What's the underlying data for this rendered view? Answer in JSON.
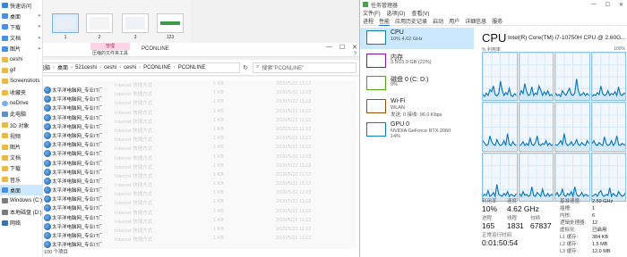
{
  "nav": {
    "items": [
      {
        "label": "快速访问",
        "icon": "star-icon",
        "pinned": false
      },
      {
        "label": "桌面",
        "icon": "desktop-icon",
        "pinned": true
      },
      {
        "label": "下载",
        "icon": "download-icon",
        "pinned": true
      },
      {
        "label": "文档",
        "icon": "document-icon",
        "pinned": true
      },
      {
        "label": "图片",
        "icon": "picture-icon",
        "pinned": true
      },
      {
        "label": "ceshi",
        "icon": "folder-icon",
        "pinned": false
      },
      {
        "label": "gif",
        "icon": "folder-icon",
        "pinned": false
      },
      {
        "label": "Screenshots",
        "icon": "folder-icon",
        "pinned": false
      },
      {
        "label": "收藏夹",
        "icon": "folder-icon",
        "pinned": false
      },
      {
        "label": "neDrive",
        "icon": "cloud-icon",
        "pinned": false
      },
      {
        "label": "此电脑",
        "icon": "pc-icon",
        "pinned": false
      },
      {
        "label": "3D 对象",
        "icon": "folder-icon",
        "pinned": false
      },
      {
        "label": "视频",
        "icon": "folder-icon",
        "pinned": false
      },
      {
        "label": "图片",
        "icon": "folder-icon",
        "pinned": false
      },
      {
        "label": "文档",
        "icon": "folder-icon",
        "pinned": false
      },
      {
        "label": "下载",
        "icon": "folder-icon",
        "pinned": false
      },
      {
        "label": "音乐",
        "icon": "folder-icon",
        "pinned": false
      },
      {
        "label": "桌面",
        "icon": "desktop-icon",
        "pinned": false,
        "selected": true
      },
      {
        "label": "Windows (C:)",
        "icon": "drive-icon",
        "pinned": false
      },
      {
        "label": "本地磁盘 (D:)",
        "icon": "drive-icon",
        "pinned": false
      },
      {
        "label": "网络",
        "icon": "network-icon",
        "pinned": false
      }
    ]
  },
  "explorer": {
    "thumbnails": [
      {
        "label": "1",
        "selected": true
      },
      {
        "label": "2",
        "selected": false
      },
      {
        "label": "3",
        "selected": false
      },
      {
        "label": "123",
        "selected": false
      }
    ],
    "ribbon": {
      "manage_tab": "管理",
      "tools_tab": "压缩的文件夹工具",
      "context_title": "PCONLINE"
    },
    "window_controls": {
      "minimize": "—",
      "maximize": "☐",
      "close": "✕"
    },
    "address": {
      "back": "←",
      "forward": "→",
      "up": "↑",
      "crumbs": [
        "此电脑",
        "桌面",
        "521ceshi",
        "ceshi",
        "ceshi",
        "PCONLINE",
        "PCONLINE"
      ],
      "refresh": "↻",
      "search_placeholder": "搜索\"PCONLINE\""
    },
    "files": [
      {
        "name": "太平洋电脑网_专业IT门户网站",
        "type": "Internet 快捷方式",
        "size": "1 KB",
        "date": "2020/5/22 11:12"
      },
      {
        "name": "太平洋电脑网_专业IT门户网站",
        "type": "Internet 快捷方式",
        "size": "1 KB",
        "date": "2020/5/22 11:12"
      },
      {
        "name": "太平洋电脑网_专业IT门户网站",
        "type": "Internet 快捷方式",
        "size": "1 KB",
        "date": "2020/5/22 11:12"
      },
      {
        "name": "太平洋电脑网_专业IT门户网站",
        "type": "Internet 快捷方式",
        "size": "1 KB",
        "date": "2020/5/22 11:12"
      },
      {
        "name": "太平洋电脑网_专业IT门户网站",
        "type": "Internet 快捷方式",
        "size": "1 KB",
        "date": "2020/5/22 11:12"
      },
      {
        "name": "太平洋电脑网_专业IT门户网站",
        "type": "Internet 快捷方式",
        "size": "1 KB",
        "date": "2020/5/22 11:12"
      },
      {
        "name": "太平洋电脑网_专业IT门户网站",
        "type": "Internet 快捷方式",
        "size": "1 KB",
        "date": "2020/5/22 11:12"
      },
      {
        "name": "太平洋电脑网_专业IT门户网站",
        "type": "Internet 快捷方式",
        "size": "1 KB",
        "date": "2020/5/22 11:12"
      },
      {
        "name": "太平洋电脑网_专业IT门户网站",
        "type": "Internet 快捷方式",
        "size": "1 KB",
        "date": "2020/5/22 11:12"
      },
      {
        "name": "太平洋电脑网_专业IT门户网站",
        "type": "Internet 快捷方式",
        "size": "1 KB",
        "date": "2020/5/22 11:12"
      },
      {
        "name": "太平洋电脑网_专业IT门户网站",
        "type": "Internet 快捷方式",
        "size": "1 KB",
        "date": "2020/5/22 11:12"
      },
      {
        "name": "太平洋电脑网_专业IT门户网站",
        "type": "Internet 快捷方式",
        "size": "1 KB",
        "date": "2020/5/22 11:12"
      },
      {
        "name": "太平洋电脑网_专业IT门户网站",
        "type": "Internet 快捷方式",
        "size": "1 KB",
        "date": "2020/5/22 11:12"
      },
      {
        "name": "太平洋电脑网_专业IT门户网站",
        "type": "Internet 快捷方式",
        "size": "1 KB",
        "date": "2020/5/22 11:12"
      },
      {
        "name": "太平洋电脑网_专业IT门户网站",
        "type": "Internet 快捷方式",
        "size": "1 KB",
        "date": "2020/5/22 11:12"
      },
      {
        "name": "太平洋电脑网_专业IT门户网站",
        "type": "Internet 快捷方式",
        "size": "1 KB",
        "date": "2020/5/22 11:12"
      },
      {
        "name": "太平洋电脑网_专业IT门户网站",
        "type": "Internet 快捷方式",
        "size": "1 KB",
        "date": "2020/5/22 11:12"
      },
      {
        "name": "太平洋电脑网_专业IT门户网站",
        "type": "Internet 快捷方式",
        "size": "1 KB",
        "date": "2020/5/22 11:12"
      }
    ],
    "status": "1,586 个项目    选中 100 个项目"
  },
  "taskmgr": {
    "title": "任务管理器",
    "window_controls": {
      "minimize": "—",
      "maximize": "☐",
      "close": "✕"
    },
    "menu": [
      "文件(F)",
      "选项(O)",
      "查看(V)"
    ],
    "tabs": [
      "进程",
      "性能",
      "应用历史记录",
      "启动",
      "用户",
      "详细信息",
      "服务"
    ],
    "active_tab": "性能",
    "resources": [
      {
        "name": "CPU",
        "sub": "10% 4.62 GHz",
        "sub2": "",
        "color": "#117dbb",
        "selected": true
      },
      {
        "name": "内存",
        "sub": "3.5/15.9 GB (22%)",
        "sub2": "",
        "color": "#8b12ae",
        "selected": false
      },
      {
        "name": "磁盘 0 (C: D:)",
        "sub": "0%",
        "sub2": "",
        "color": "#4da60c",
        "selected": false
      },
      {
        "name": "Wi-Fi",
        "sub": "WLAN",
        "sub2": "发送: 0 接收: 96.0 Kbps",
        "color": "#a74f01",
        "selected": false
      },
      {
        "name": "GPU 0",
        "sub": "NVIDIA GeForce RTX 2060",
        "sub2": "14%",
        "color": "#117dbb",
        "selected": false
      }
    ],
    "cpu": {
      "heading": "CPU",
      "model": "Intel(R) Core(TM) i7-10750H CPU @ 2.60G...",
      "graph_caption_left": "% 利用率",
      "graph_caption_right": "100%",
      "utilization_label": "利用率",
      "utilization": "10%",
      "speed_label": "速度",
      "speed": "4.62 GHz",
      "processes_label": "进程",
      "processes": "165",
      "threads_label": "线程",
      "threads": "1831",
      "handles_label": "句柄",
      "handles": "67837",
      "uptime_label": "正常运行时间",
      "uptime": "0:01:50:54",
      "details": [
        {
          "k": "基准速度:",
          "v": "2.59 GHz"
        },
        {
          "k": "插槽:",
          "v": "1"
        },
        {
          "k": "内核:",
          "v": "6"
        },
        {
          "k": "逻辑处理器:",
          "v": "12"
        },
        {
          "k": "虚拟化:",
          "v": "已启用"
        },
        {
          "k": "L1 缓存:",
          "v": "384 KB"
        },
        {
          "k": "L2 缓存:",
          "v": "1.5 MB"
        },
        {
          "k": "L3 缓存:",
          "v": "12.0 MB"
        }
      ],
      "cores": [
        [
          0.12,
          0.08,
          0.15,
          0.1,
          0.22,
          0.18,
          0.3,
          0.12,
          0.09,
          0.14,
          0.4,
          0.2,
          0.1,
          0.16,
          0.12,
          0.25,
          0.1,
          0.08,
          0.14,
          0.1
        ],
        [
          0.1,
          0.2,
          0.14,
          0.35,
          0.18,
          0.1,
          0.12,
          0.28,
          0.1,
          0.15,
          0.12,
          0.3,
          0.22,
          0.1,
          0.18,
          0.12,
          0.2,
          0.1,
          0.12,
          0.09
        ],
        [
          0.15,
          0.1,
          0.12,
          0.08,
          0.2,
          0.14,
          0.1,
          0.18,
          0.25,
          0.12,
          0.1,
          0.15,
          0.45,
          0.2,
          0.1,
          0.12,
          0.16,
          0.1,
          0.14,
          0.1
        ],
        [
          0.08,
          0.12,
          0.1,
          0.16,
          0.12,
          0.3,
          0.14,
          0.1,
          0.12,
          0.2,
          0.1,
          0.14,
          0.12,
          0.18,
          0.1,
          0.28,
          0.12,
          0.1,
          0.15,
          0.12
        ],
        [
          0.2,
          0.15,
          0.1,
          0.12,
          0.3,
          0.18,
          0.12,
          0.1,
          0.22,
          0.14,
          0.1,
          0.12,
          0.2,
          0.1,
          0.35,
          0.12,
          0.1,
          0.18,
          0.12,
          0.1
        ],
        [
          0.1,
          0.12,
          0.18,
          0.1,
          0.14,
          0.1,
          0.25,
          0.12,
          0.1,
          0.16,
          0.3,
          0.12,
          0.1,
          0.14,
          0.12,
          0.2,
          0.1,
          0.15,
          0.1,
          0.12
        ],
        [
          0.12,
          0.1,
          0.14,
          0.2,
          0.12,
          0.35,
          0.15,
          0.1,
          0.12,
          0.18,
          0.1,
          0.14,
          0.22,
          0.12,
          0.1,
          0.16,
          0.12,
          0.1,
          0.2,
          0.14
        ],
        [
          0.14,
          0.2,
          0.12,
          0.1,
          0.16,
          0.12,
          0.1,
          0.28,
          0.14,
          0.1,
          0.12,
          0.2,
          0.1,
          0.15,
          0.3,
          0.12,
          0.1,
          0.14,
          0.12,
          0.1
        ],
        [
          0.1,
          0.14,
          0.12,
          0.22,
          0.1,
          0.12,
          0.18,
          0.1,
          0.35,
          0.14,
          0.12,
          0.1,
          0.16,
          0.12,
          0.2,
          0.1,
          0.14,
          0.12,
          0.1,
          0.16
        ],
        [
          0.16,
          0.1,
          0.2,
          0.12,
          0.14,
          0.1,
          0.12,
          0.3,
          0.12,
          0.1,
          0.18,
          0.14,
          0.1,
          0.25,
          0.12,
          0.1,
          0.16,
          0.1,
          0.14,
          0.12
        ],
        [
          0.12,
          0.18,
          0.1,
          0.14,
          0.25,
          0.12,
          0.1,
          0.16,
          0.12,
          0.2,
          0.1,
          0.3,
          0.14,
          0.1,
          0.12,
          0.18,
          0.1,
          0.14,
          0.12,
          0.1
        ],
        [
          0.1,
          0.12,
          0.15,
          0.1,
          0.18,
          0.22,
          0.12,
          0.1,
          0.14,
          0.12,
          0.28,
          0.1,
          0.16,
          0.12,
          0.1,
          0.2,
          0.14,
          0.1,
          0.12,
          0.18
        ]
      ]
    }
  }
}
